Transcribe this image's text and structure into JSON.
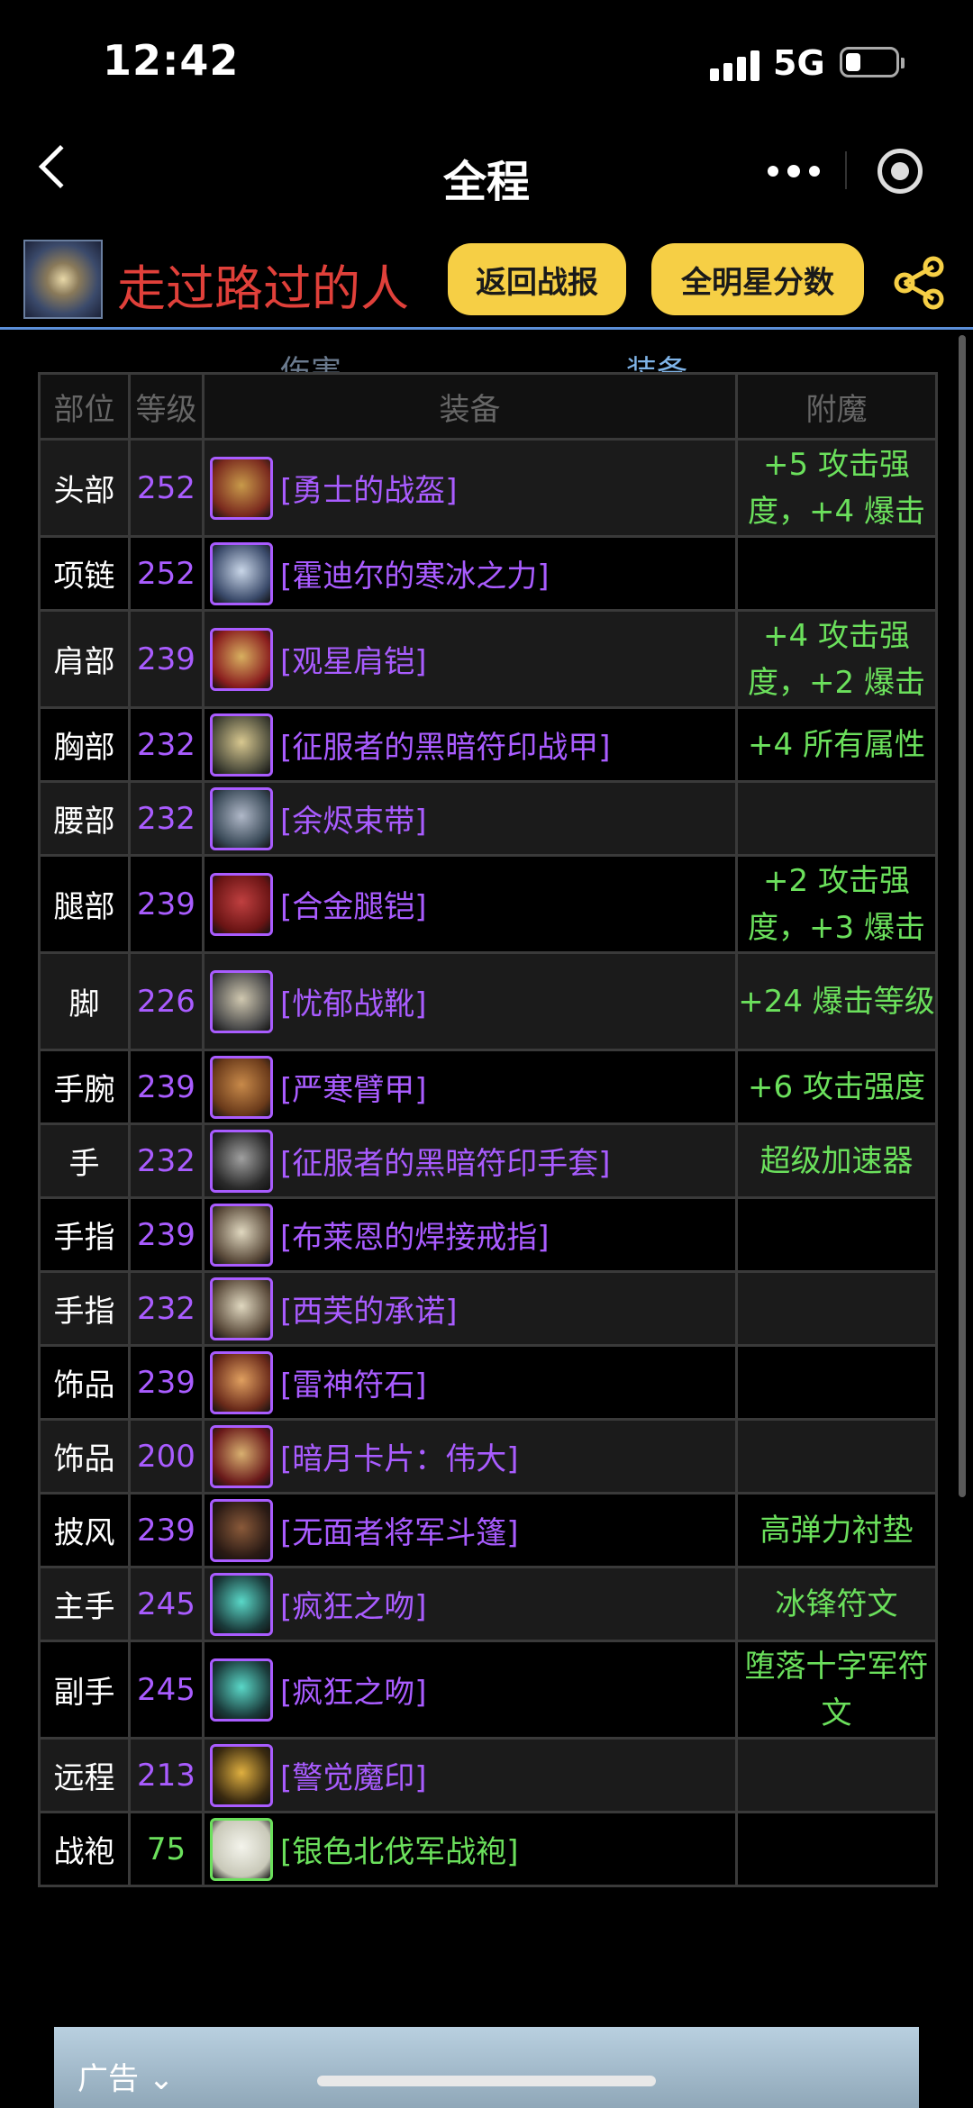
{
  "status": {
    "time": "12:42",
    "network": "5G"
  },
  "nav": {
    "title": "全程"
  },
  "profile": {
    "name": "走过路过的人",
    "report_button": "返回战报",
    "allstar_button": "全明星分数"
  },
  "tabs": {
    "damage": "伤害",
    "gear": "装备"
  },
  "table": {
    "headers": {
      "slot": "部位",
      "level": "等级",
      "item": "装备",
      "enchant": "附魔"
    },
    "rows": [
      {
        "slot": "头部",
        "level": "252",
        "item": "[勇士的战盔]",
        "enchant": "+5 攻击强度，+4 爆击",
        "icon": "helmet-icon",
        "quality": "epic"
      },
      {
        "slot": "项链",
        "level": "252",
        "item": "[霍迪尔的寒冰之力]",
        "enchant": "",
        "icon": "necklace-icon",
        "quality": "epic"
      },
      {
        "slot": "肩部",
        "level": "239",
        "item": "[观星肩铠]",
        "enchant": "+4 攻击强度，+2 爆击",
        "icon": "shoulder-icon",
        "quality": "epic"
      },
      {
        "slot": "胸部",
        "level": "232",
        "item": "[征服者的黑暗符印战甲]",
        "enchant": "+4 所有属性",
        "icon": "chest-icon",
        "quality": "epic"
      },
      {
        "slot": "腰部",
        "level": "232",
        "item": "[余烬束带]",
        "enchant": "",
        "icon": "belt-icon",
        "quality": "epic"
      },
      {
        "slot": "腿部",
        "level": "239",
        "item": "[合金腿铠]",
        "enchant": "+2 攻击强度，+3 爆击",
        "icon": "legs-icon",
        "quality": "epic"
      },
      {
        "slot": "脚",
        "level": "226",
        "item": "[忧郁战靴]",
        "enchant": "+24 爆击等级",
        "icon": "boots-icon",
        "quality": "epic"
      },
      {
        "slot": "手腕",
        "level": "239",
        "item": "[严寒臂甲]",
        "enchant": "+6 攻击强度",
        "icon": "bracer-icon",
        "quality": "epic"
      },
      {
        "slot": "手",
        "level": "232",
        "item": "[征服者的黑暗符印手套]",
        "enchant": "超级加速器",
        "icon": "gloves-icon",
        "quality": "epic"
      },
      {
        "slot": "手指",
        "level": "239",
        "item": "[布莱恩的焊接戒指]",
        "enchant": "",
        "icon": "ring-icon",
        "quality": "epic"
      },
      {
        "slot": "手指",
        "level": "232",
        "item": "[西芙的承诺]",
        "enchant": "",
        "icon": "ring-icon",
        "quality": "epic"
      },
      {
        "slot": "饰品",
        "level": "239",
        "item": "[雷神符石]",
        "enchant": "",
        "icon": "rune-stone-icon",
        "quality": "epic"
      },
      {
        "slot": "饰品",
        "level": "200",
        "item": "[暗月卡片：伟大]",
        "enchant": "",
        "icon": "card-icon",
        "quality": "epic"
      },
      {
        "slot": "披风",
        "level": "239",
        "item": "[无面者将军斗篷]",
        "enchant": "高弹力衬垫",
        "icon": "cloak-icon",
        "quality": "epic"
      },
      {
        "slot": "主手",
        "level": "245",
        "item": "[疯狂之吻]",
        "enchant": "冰锋符文",
        "icon": "weapon-icon",
        "quality": "epic"
      },
      {
        "slot": "副手",
        "level": "245",
        "item": "[疯狂之吻]",
        "enchant": "堕落十字军符文",
        "icon": "weapon-icon",
        "quality": "epic"
      },
      {
        "slot": "远程",
        "level": "213",
        "item": "[警觉魔印]",
        "enchant": "",
        "icon": "sigil-icon",
        "quality": "epic"
      },
      {
        "slot": "战袍",
        "level": "75",
        "item": "[银色北伐军战袍]",
        "enchant": "",
        "icon": "tabard-icon",
        "quality": "uncommon"
      }
    ]
  },
  "ad": {
    "label": "广告 ⌄"
  },
  "colors": {
    "epic": "#a95cff",
    "uncommon": "#6be05c",
    "enchant": "#6be05c",
    "button": "#f6cf45",
    "name": "#e0403a"
  }
}
